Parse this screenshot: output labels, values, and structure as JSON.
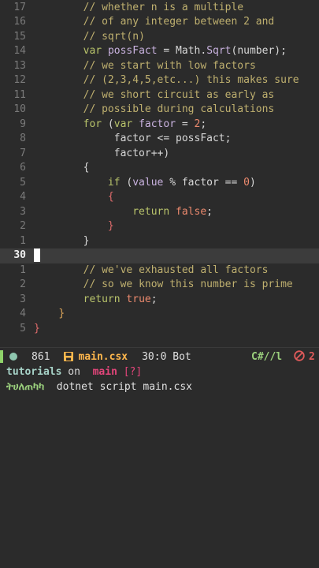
{
  "editor": {
    "lines": [
      {
        "num": "17",
        "tokens": [
          {
            "t": "        "
          },
          {
            "c": "cmt",
            "t": "// whether n is a multiple"
          }
        ]
      },
      {
        "num": "16",
        "tokens": [
          {
            "t": "        "
          },
          {
            "c": "cmt",
            "t": "// of any integer between 2 and"
          }
        ]
      },
      {
        "num": "15",
        "tokens": [
          {
            "t": "        "
          },
          {
            "c": "cmt",
            "t": "// sqrt(n)"
          }
        ]
      },
      {
        "num": "14",
        "tokens": [
          {
            "t": "        "
          },
          {
            "c": "kw",
            "t": "var"
          },
          {
            "c": "pl",
            "t": " "
          },
          {
            "c": "tp",
            "t": "possFact"
          },
          {
            "c": "pl",
            "t": " = Math."
          },
          {
            "c": "fn",
            "t": "Sqrt"
          },
          {
            "c": "pl",
            "t": "(number);"
          }
        ]
      },
      {
        "num": "13",
        "tokens": [
          {
            "t": "        "
          },
          {
            "c": "cmt",
            "t": "// we start with low factors"
          }
        ]
      },
      {
        "num": "12",
        "tokens": [
          {
            "t": "        "
          },
          {
            "c": "cmt",
            "t": "// (2,3,4,5,etc...) this makes sure"
          }
        ]
      },
      {
        "num": "11",
        "tokens": [
          {
            "t": "        "
          },
          {
            "c": "cmt",
            "t": "// we short circuit as early as"
          }
        ]
      },
      {
        "num": "10",
        "tokens": [
          {
            "t": "        "
          },
          {
            "c": "cmt",
            "t": "// possible during calculations"
          }
        ]
      },
      {
        "num": "9",
        "tokens": [
          {
            "t": "        "
          },
          {
            "c": "kw",
            "t": "for"
          },
          {
            "c": "pl",
            "t": " ("
          },
          {
            "c": "kw",
            "t": "var"
          },
          {
            "c": "pl",
            "t": " "
          },
          {
            "c": "tp",
            "t": "factor"
          },
          {
            "c": "pl",
            "t": " = "
          },
          {
            "c": "num",
            "t": "2"
          },
          {
            "c": "pl",
            "t": ";"
          }
        ]
      },
      {
        "num": "8",
        "tokens": [
          {
            "t": "             "
          },
          {
            "c": "pl",
            "t": "factor <= possFact;"
          }
        ]
      },
      {
        "num": "7",
        "tokens": [
          {
            "t": "             "
          },
          {
            "c": "pl",
            "t": "factor++)"
          }
        ]
      },
      {
        "num": "6",
        "tokens": [
          {
            "t": "        "
          },
          {
            "c": "pl",
            "t": "{"
          }
        ]
      },
      {
        "num": "5",
        "tokens": [
          {
            "t": "            "
          },
          {
            "c": "kw",
            "t": "if"
          },
          {
            "c": "pl",
            "t": " ("
          },
          {
            "c": "tp",
            "t": "value"
          },
          {
            "c": "pl",
            "t": " % factor == "
          },
          {
            "c": "num",
            "t": "0"
          },
          {
            "c": "pl",
            "t": ")"
          }
        ]
      },
      {
        "num": "4",
        "tokens": [
          {
            "t": "            "
          },
          {
            "c": "br2",
            "t": "{"
          }
        ]
      },
      {
        "num": "3",
        "tokens": [
          {
            "t": "                "
          },
          {
            "c": "kw",
            "t": "return"
          },
          {
            "c": "pl",
            "t": " "
          },
          {
            "c": "bool",
            "t": "false"
          },
          {
            "c": "pl",
            "t": ";"
          }
        ]
      },
      {
        "num": "2",
        "tokens": [
          {
            "t": "            "
          },
          {
            "c": "br2",
            "t": "}"
          }
        ]
      },
      {
        "num": "1",
        "tokens": [
          {
            "t": "        "
          },
          {
            "c": "pl",
            "t": "}"
          }
        ]
      },
      {
        "num": "30",
        "current": true,
        "tokens": []
      },
      {
        "num": "1",
        "tokens": [
          {
            "t": "        "
          },
          {
            "c": "cmt",
            "t": "// we've exhausted all factors"
          }
        ]
      },
      {
        "num": "2",
        "tokens": [
          {
            "t": "        "
          },
          {
            "c": "cmt",
            "t": "// so we know this number is prime"
          }
        ]
      },
      {
        "num": "3",
        "tokens": [
          {
            "t": "        "
          },
          {
            "c": "kw",
            "t": "return"
          },
          {
            "c": "pl",
            "t": " "
          },
          {
            "c": "bool",
            "t": "true"
          },
          {
            "c": "pl",
            "t": ";"
          }
        ]
      },
      {
        "num": "4",
        "tokens": [
          {
            "t": "    "
          },
          {
            "c": "br",
            "t": "}"
          }
        ]
      },
      {
        "num": "5",
        "tokens": [
          {
            "c": "br2",
            "t": "}"
          }
        ]
      }
    ]
  },
  "statusline": {
    "bytes": "861",
    "filename": "main.csx",
    "position": "30:0 Bot",
    "language": "C#//l",
    "error_count": "2"
  },
  "terminal": {
    "line1": {
      "dir": "tutorials",
      "on": " on ",
      "branch_icon": "",
      "branch": "main",
      "flags": "[?]"
    },
    "line2": {
      "prompt": "ትሀለጠካካ",
      "command": "dotnet script main.csx"
    }
  },
  "colors": {
    "background": "#2b2b2b",
    "comment": "#bfb06f",
    "keyword": "#b9c46b",
    "filename": "#ffb74d",
    "error": "#e05a5a",
    "branch": "#e2457a"
  }
}
